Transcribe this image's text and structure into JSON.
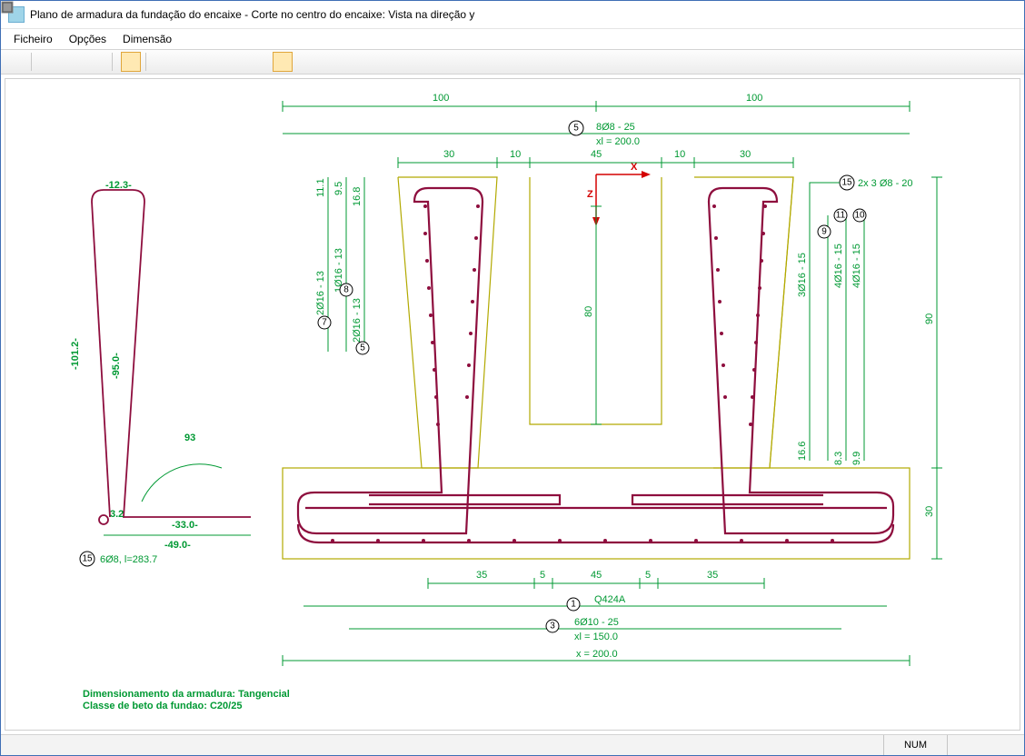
{
  "window": {
    "title": "Plano de armadura da fundação do encaixe - Corte no centro do encaixe: Vista na direção y"
  },
  "menu": {
    "file": "Ficheiro",
    "options": "Opções",
    "dimension": "Dimensão"
  },
  "status": {
    "num": "NUM"
  },
  "tags": {
    "t1": "1",
    "t3": "3",
    "t5": "5",
    "t7": "7",
    "t8": "8",
    "t9": "9",
    "t10": "10",
    "t11": "11",
    "t15": "15",
    "t15b": "15"
  },
  "dims_top": {
    "l100": "100",
    "r100": "100",
    "d30": "30",
    "d10": "10",
    "d45": "45",
    "d10b": "10",
    "d30b": "30"
  },
  "dims_vert": {
    "v11_1": "11.1",
    "v9_5": "9.5",
    "v16_8": "16.8",
    "v1_16_13": "1Ø16 - 13",
    "v2_16_13": "2Ø16 - 13",
    "v2_16_13b": "2Ø16 - 13",
    "v80": "80",
    "v90": "90",
    "v30": "30",
    "r3_16_15": "3Ø16 - 15",
    "r4_16_15a": "4Ø16 - 15",
    "r4_16_15b": "4Ø16 - 15",
    "v16_6": "16.6",
    "v8_3": "8.3",
    "v9_9": "9.9"
  },
  "labels": {
    "top5": "8Ø8 - 25",
    "top5_xl": "xl = 200.0",
    "r15": "2x 3 Ø8 - 20",
    "q": "Q424A",
    "b3": "6Ø10 - 25",
    "b3xl": "xl = 150.0",
    "bx": "x = 200.0"
  },
  "dims_bottom": {
    "b35": "35",
    "b5": "5",
    "b45": "45",
    "b5b": "5",
    "b35b": "35"
  },
  "left_detail": {
    "top": "-12.3-",
    "h101": "-101.2-",
    "h95": "-95.0-",
    "ang": "93",
    "d32": "3.2",
    "d33": "-33.0-",
    "d49": "-49.0-",
    "spec": "6Ø8, l=283.7"
  },
  "footer": {
    "l1": "Dimensionamento  da  armadura: Tangencial",
    "l2": "Classe de beto da fundao: C20/25"
  }
}
